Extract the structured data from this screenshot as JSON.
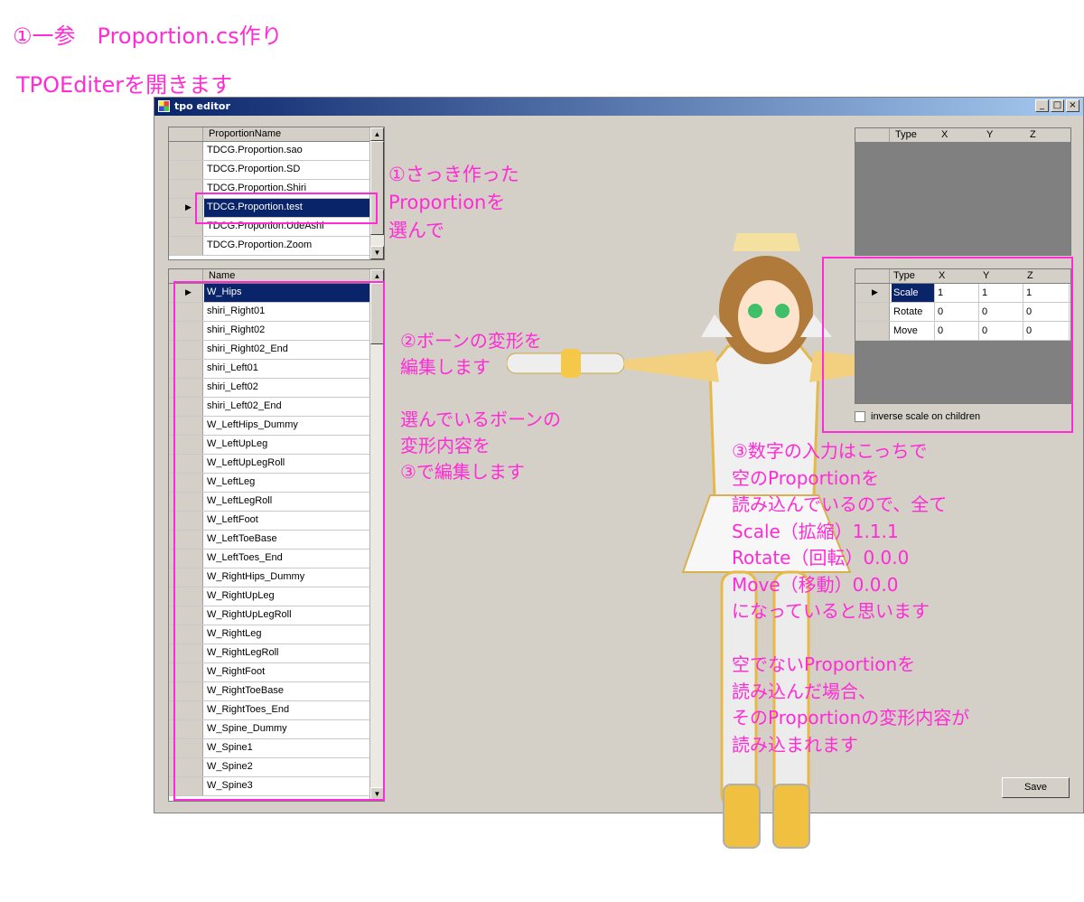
{
  "annotations": {
    "header_line1": "①一参　Proportion.cs作り",
    "header_line2": "TPOEditerを開きます",
    "note1": "①さっき作った\nProportionを\n選んで",
    "note2": "②ボーンの変形を\n編集します\n\n選んでいるボーンの\n変形内容を\n③で編集します",
    "note3": "③数字の入力はこっちで\n空のProportionを\n読み込んでいるので、全て\nScale（拡縮）1.1.1\nRotate（回転）0.0.0\nMove（移動）0.0.0\nになっていると思います\n\n空でないProportionを\n読み込んだ場合、\nそのProportionの変形内容が\n読み込まれます"
  },
  "window": {
    "title": "tpo editor",
    "buttons": [
      "_",
      "□",
      "×"
    ]
  },
  "proportion_grid": {
    "header": "ProportionName",
    "rows": [
      "TDCG.Proportion.sao",
      "TDCG.Proportion.SD",
      "TDCG.Proportion.Shiri",
      "TDCG.Proportion.test",
      "TDCG.Proportion.UdeAshi",
      "TDCG.Proportion.Zoom"
    ],
    "selected": 3
  },
  "bone_grid": {
    "header": "Name",
    "rows": [
      "W_Hips",
      "shiri_Right01",
      "shiri_Right02",
      "shiri_Right02_End",
      "shiri_Left01",
      "shiri_Left02",
      "shiri_Left02_End",
      "W_LeftHips_Dummy",
      "W_LeftUpLeg",
      "W_LeftUpLegRoll",
      "W_LeftLeg",
      "W_LeftLegRoll",
      "W_LeftFoot",
      "W_LeftToeBase",
      "W_LeftToes_End",
      "W_RightHips_Dummy",
      "W_RightUpLeg",
      "W_RightUpLegRoll",
      "W_RightLeg",
      "W_RightLegRoll",
      "W_RightFoot",
      "W_RightToeBase",
      "W_RightToes_End",
      "W_Spine_Dummy",
      "W_Spine1",
      "W_Spine2",
      "W_Spine3"
    ],
    "selected": 0
  },
  "top_right_grid": {
    "columns": [
      "Type",
      "X",
      "Y",
      "Z"
    ]
  },
  "transform_grid": {
    "columns": [
      "Type",
      "X",
      "Y",
      "Z"
    ],
    "rows": [
      {
        "type": "Scale",
        "x": "1",
        "y": "1",
        "z": "1"
      },
      {
        "type": "Rotate",
        "x": "0",
        "y": "0",
        "z": "0"
      },
      {
        "type": "Move",
        "x": "0",
        "y": "0",
        "z": "0"
      }
    ]
  },
  "checkbox": {
    "label": "inverse scale on children",
    "checked": false
  },
  "save_button": "Save",
  "colors": {
    "annotation": "#ff2bd6",
    "selection": "#0a246a",
    "window_bg": "#d4d0c8",
    "grid_empty": "#808080"
  }
}
